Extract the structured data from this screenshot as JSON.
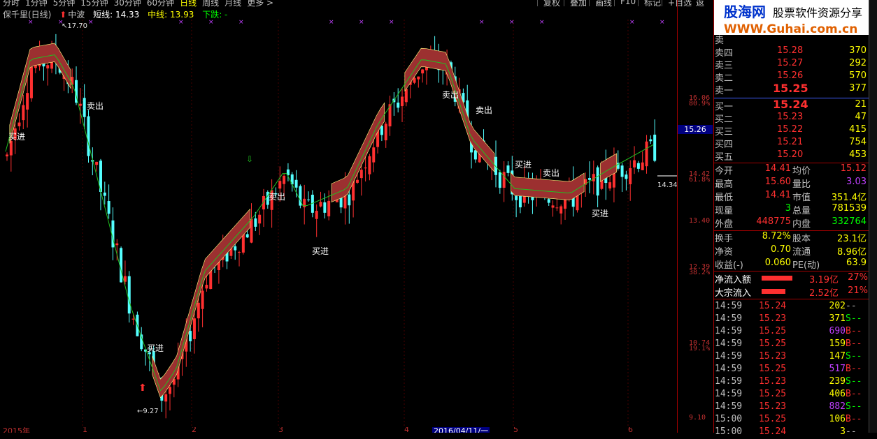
{
  "toolbar": {
    "periods": [
      "分时",
      "1分钟",
      "5分钟",
      "15分钟",
      "30分钟",
      "60分钟",
      "日线",
      "周线",
      "月线",
      "更多 >"
    ],
    "active_period": "日线",
    "buttons": [
      "复权",
      "叠加",
      "画线",
      "F10",
      "标记",
      "+自选",
      "返回"
    ]
  },
  "indicator": {
    "name": "保千里(日线)",
    "mid_wave": "中波",
    "short_line": "短线: 14.33",
    "mid_line": "中线: 13.93",
    "trend": "下跌: -"
  },
  "chart": {
    "axis_labels": [
      "16.06",
      "80.9%",
      "14.42",
      "61.8%",
      "13.40",
      "12.39",
      "38.2%",
      "10.74",
      "19.1%",
      "9.10"
    ],
    "current_price_tag": "15.26",
    "high_marker": "17.70",
    "low_marker": "9.27",
    "last_marker": "14.34",
    "x_labels": [
      "2015年",
      "1",
      "2",
      "3",
      "4",
      "2016/04/11/一",
      "5",
      "6"
    ],
    "signals": {
      "buy": "买进",
      "sell": "卖出"
    },
    "colors": {
      "up": "#ff3030",
      "down": "#54ffff",
      "band": "#9c3030",
      "ma": "#20c020"
    }
  },
  "chart_data": {
    "type": "candlestick",
    "ylim": [
      9.1,
      17.7
    ],
    "high_label": 17.7,
    "low_label": 9.27,
    "last_label": 14.34,
    "current_price": 15.26
  },
  "logo": {
    "site": "股海网",
    "slogan": "股票软件资源分享",
    "url": "WWW.Guhai.com.cn"
  },
  "quote": {
    "partial_label": "卖",
    "asks": [
      {
        "label": "卖四",
        "price": "15.28",
        "vol": "370"
      },
      {
        "label": "卖三",
        "price": "15.27",
        "vol": "292"
      },
      {
        "label": "卖二",
        "price": "15.26",
        "vol": "570"
      },
      {
        "label": "卖一",
        "price": "15.25",
        "vol": "377"
      }
    ],
    "bids": [
      {
        "label": "买一",
        "price": "15.24",
        "vol": "21"
      },
      {
        "label": "买二",
        "price": "15.23",
        "vol": "47"
      },
      {
        "label": "买三",
        "price": "15.22",
        "vol": "415"
      },
      {
        "label": "买四",
        "price": "15.21",
        "vol": "754"
      },
      {
        "label": "买五",
        "price": "15.20",
        "vol": "453"
      }
    ],
    "stats": [
      {
        "k1": "今开",
        "v1": "14.41",
        "k2": "均价",
        "v2": "15.12"
      },
      {
        "k1": "最高",
        "v1": "15.60",
        "k2": "量比",
        "v2": "3.03"
      },
      {
        "k1": "最低",
        "v1": "14.41",
        "k2": "市值",
        "v2": "351.4亿"
      },
      {
        "k1": "现量",
        "v1": "3",
        "k2": "总量",
        "v2": "781539"
      },
      {
        "k1": "外盘",
        "v1": "448775",
        "k2": "内盘",
        "v2": "332764"
      }
    ],
    "stats2": [
      {
        "k1": "换手",
        "v1": "8.72%",
        "k2": "股本",
        "v2": "23.1亿"
      },
      {
        "k1": "净资",
        "v1": "0.70",
        "k2": "流通",
        "v2": "8.96亿"
      },
      {
        "k1": "收益(-)",
        "v1": "0.060",
        "k2": "PE(动)",
        "v2": "63.9"
      }
    ],
    "flows": [
      {
        "k": "净流入额",
        "v": "3.19亿",
        "p": "27%"
      },
      {
        "k": "大宗流入",
        "v": "2.52亿",
        "p": "21%"
      }
    ],
    "ticks": [
      {
        "t": "14:59",
        "p": "15.24",
        "v": "202",
        "s": "--"
      },
      {
        "t": "14:59",
        "p": "15.23",
        "v": "371",
        "s": "S--"
      },
      {
        "t": "14:59",
        "p": "15.25",
        "v": "690",
        "s": "B--"
      },
      {
        "t": "14:59",
        "p": "15.25",
        "v": "159",
        "s": "B--"
      },
      {
        "t": "14:59",
        "p": "15.23",
        "v": "147",
        "s": "S--"
      },
      {
        "t": "14:59",
        "p": "15.25",
        "v": "517",
        "s": "B--"
      },
      {
        "t": "14:59",
        "p": "15.23",
        "v": "239",
        "s": "S--"
      },
      {
        "t": "14:59",
        "p": "15.25",
        "v": "406",
        "s": "B--"
      },
      {
        "t": "14:59",
        "p": "15.23",
        "v": "882",
        "s": "S--"
      },
      {
        "t": "15:00",
        "p": "15.25",
        "v": "106",
        "s": "B--"
      },
      {
        "t": "15:00",
        "p": "15.24",
        "v": "3",
        "s": "--"
      }
    ]
  }
}
